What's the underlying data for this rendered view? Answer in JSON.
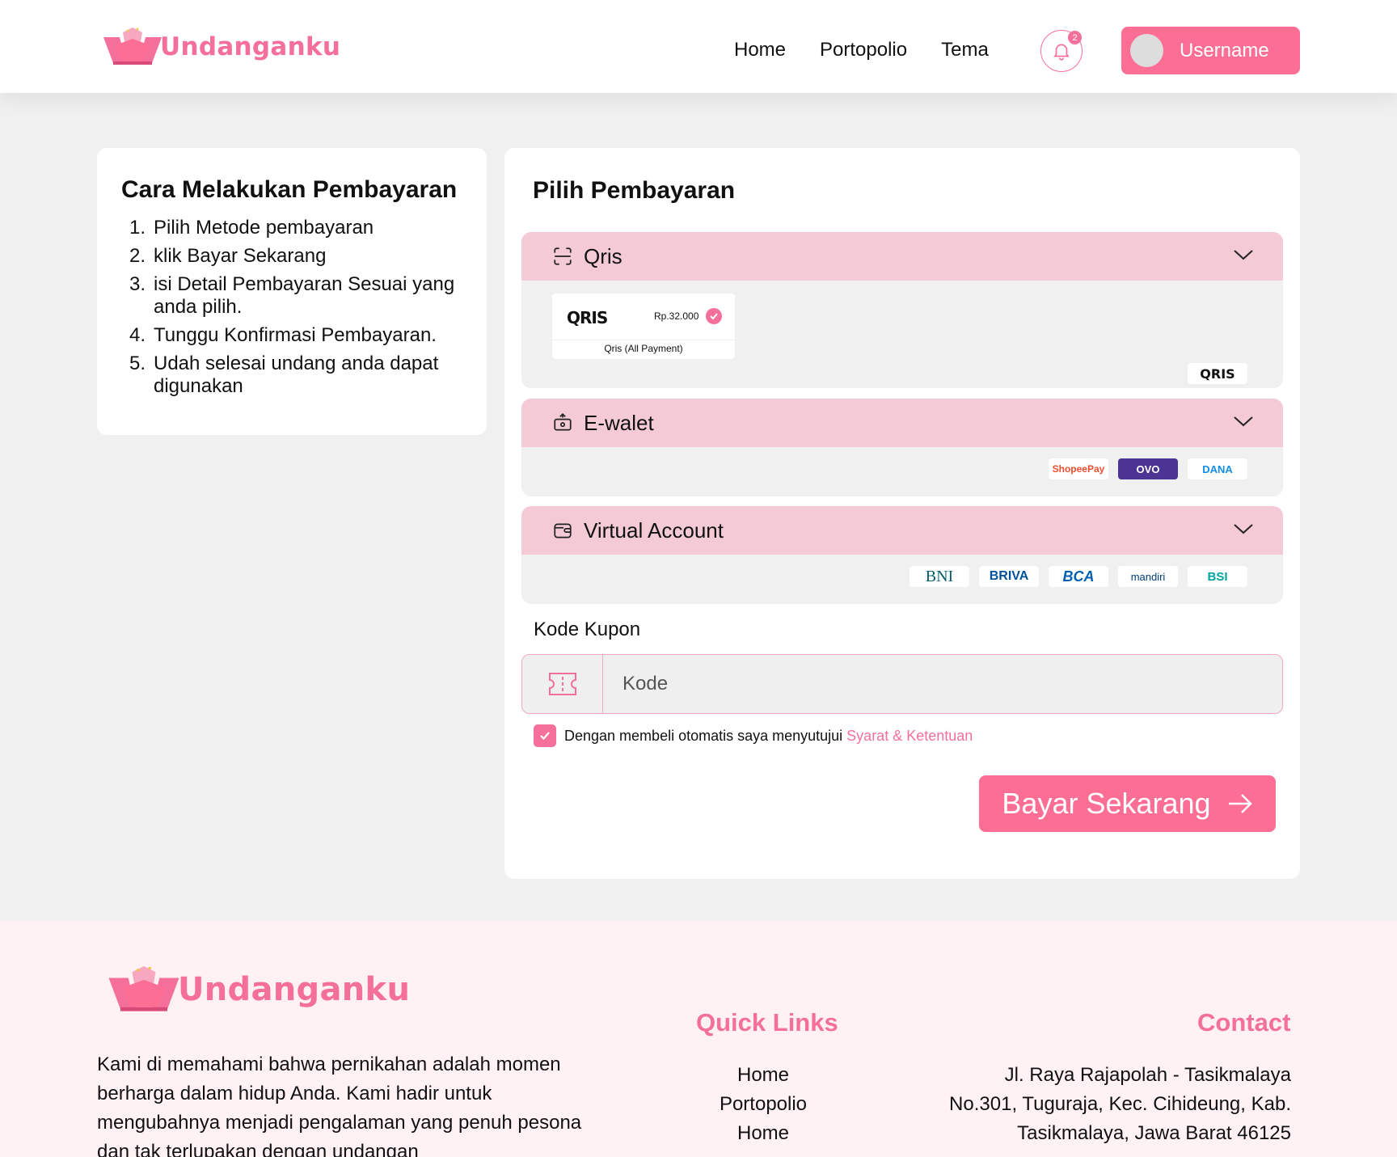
{
  "header": {
    "brand": "Undanganku",
    "nav": [
      "Home",
      "Portopolio",
      "Tema"
    ],
    "notification_count": "2",
    "username": "Username"
  },
  "instructions": {
    "title": "Cara Melakukan Pembayaran",
    "steps": [
      {
        "num": "1.",
        "text": "Pilih Metode pembayaran"
      },
      {
        "num": "2.",
        "text": "klik Bayar Sekarang"
      },
      {
        "num": "3.",
        "text": "isi Detail Pembayaran Sesuai yang anda pilih."
      },
      {
        "num": "4.",
        "text": "Tunggu Konfirmasi Pembayaran."
      },
      {
        "num": "5.",
        "text": "Udah selesai undang anda dapat digunakan"
      }
    ]
  },
  "payment": {
    "title": "Pilih Pembayaran",
    "qris": {
      "label": "Qris",
      "card_logo": "QRIS",
      "price": "Rp.32.000",
      "card_sub": "Qris (All Payment)",
      "badge": "QRIS"
    },
    "ewallet": {
      "label": "E-walet",
      "providers": [
        "ShopeePay",
        "OVO",
        "DANA"
      ]
    },
    "va": {
      "label": "Virtual Account",
      "banks": [
        "BNI",
        "BRIVA",
        "BCA",
        "mandiri",
        "BSI"
      ]
    },
    "coupon_label": "Kode Kupon",
    "coupon_placeholder": "Kode",
    "agree_text": "Dengan membeli otomatis saya menyutujui",
    "agree_link": "Syarat & Ketentuan",
    "pay_button": "Bayar Sekarang"
  },
  "footer": {
    "brand": "Undanganku",
    "description": "Kami di  memahami bahwa pernikahan adalah momen berharga dalam hidup Anda. Kami hadir untuk mengubahnya menjadi pengalaman yang penuh pesona dan tak terlupakan dengan undangan",
    "quick_links_title": "Quick Links",
    "quick_links": [
      "Home",
      "Portopolio",
      "Home"
    ],
    "contact_title": "Contact",
    "address_lines": [
      "Jl. Raya Rajapolah - Tasikmalaya",
      "No.301, Tuguraja, Kec. Cihideung, Kab.",
      "Tasikmalaya, Jawa Barat 46125"
    ]
  },
  "colors": {
    "accent": "#fd6e95",
    "accent_text": "#f4709a",
    "accordion_header": "#f4cad6",
    "footer_bg": "#fff1f4"
  }
}
